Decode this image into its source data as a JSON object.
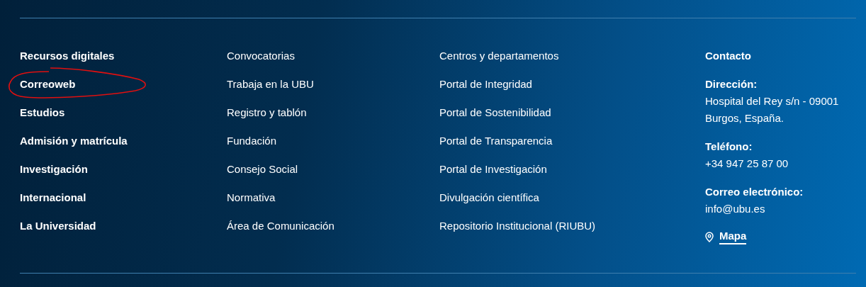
{
  "link_columns": [
    {
      "kind": "primary",
      "links": [
        {
          "label": "Recursos digitales",
          "circled": false
        },
        {
          "label": "Correoweb",
          "circled": true
        },
        {
          "label": "Estudios",
          "circled": false
        },
        {
          "label": "Admisión y matrícula",
          "circled": false
        },
        {
          "label": "Investigación",
          "circled": false
        },
        {
          "label": "Internacional",
          "circled": false
        },
        {
          "label": "La Universidad",
          "circled": false
        }
      ]
    },
    {
      "kind": "secondary",
      "links": [
        {
          "label": "Convocatorias",
          "circled": false
        },
        {
          "label": "Trabaja en la UBU",
          "circled": false
        },
        {
          "label": "Registro y tablón",
          "circled": false
        },
        {
          "label": "Fundación",
          "circled": false
        },
        {
          "label": "Consejo Social",
          "circled": false
        },
        {
          "label": "Normativa",
          "circled": false
        },
        {
          "label": "Área de Comunicación",
          "circled": false
        }
      ]
    },
    {
      "kind": "secondary",
      "links": [
        {
          "label": "Centros y departamentos",
          "circled": false
        },
        {
          "label": "Portal de Integridad",
          "circled": false
        },
        {
          "label": "Portal de Sostenibilidad",
          "circled": false
        },
        {
          "label": "Portal de Transparencia",
          "circled": false
        },
        {
          "label": "Portal de Investigación",
          "circled": false
        },
        {
          "label": "Divulgación científica",
          "circled": false
        },
        {
          "label": "Repositorio Institucional (RIUBU)",
          "circled": false
        }
      ]
    }
  ],
  "contact": {
    "title": "Contacto",
    "groups": [
      {
        "label": "Dirección:",
        "lines": [
          "Hospital del Rey s/n - 09001",
          "Burgos, España."
        ]
      },
      {
        "label": "Teléfono:",
        "lines": [
          "+34 947 25 87 00"
        ]
      },
      {
        "label": "Correo electrónico:",
        "lines": [
          "info@ubu.es"
        ]
      }
    ],
    "map_link": {
      "label": "Mapa"
    }
  }
}
